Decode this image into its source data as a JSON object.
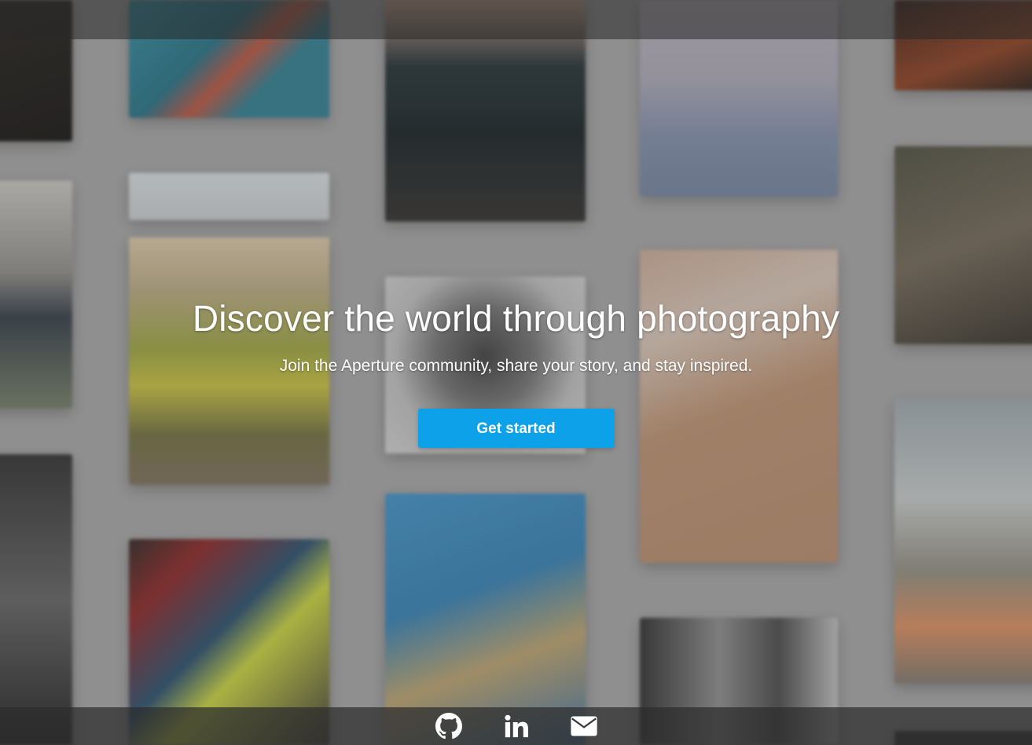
{
  "hero": {
    "title": "Discover the world through photography",
    "subtitle": "Join the Aperture community, share your story, and stay inspired.",
    "cta_label": "Get started"
  },
  "footer": {
    "social_icons": [
      "github-icon",
      "linkedin-icon",
      "envelope-icon"
    ]
  },
  "colors": {
    "accent": "#0da1ea",
    "text": "#ffffff",
    "bar": "#2d2d2d"
  }
}
